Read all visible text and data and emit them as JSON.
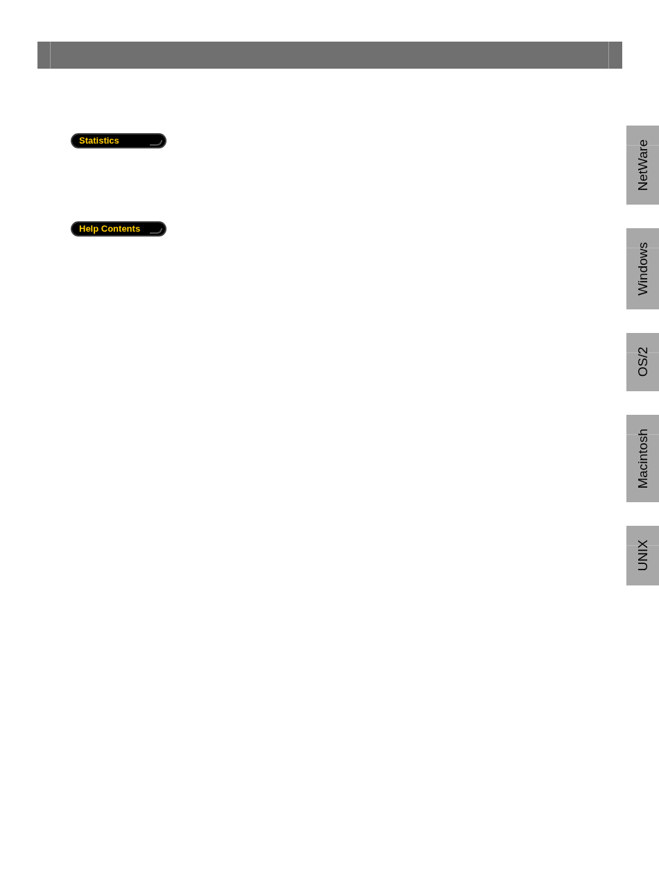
{
  "buttons": [
    "Statistics",
    "Help Contents"
  ],
  "side_tabs": [
    "NetWare",
    "Windows",
    "OS/2",
    "Macintosh",
    "UNIX"
  ]
}
